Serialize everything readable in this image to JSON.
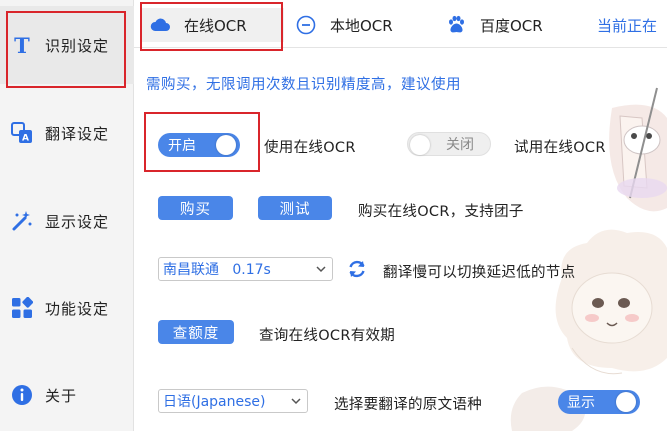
{
  "sidebar": {
    "items": [
      {
        "label": "识别设定",
        "icon": "text-t-icon"
      },
      {
        "label": "翻译设定",
        "icon": "translate-icon"
      },
      {
        "label": "显示设定",
        "icon": "magic-wand-icon"
      },
      {
        "label": "功能设定",
        "icon": "apps-icon"
      },
      {
        "label": "关于",
        "icon": "info-icon"
      }
    ]
  },
  "tabs": [
    {
      "label": "在线OCR",
      "icon": "cloud-icon"
    },
    {
      "label": "本地OCR",
      "icon": "minus-circle-icon"
    },
    {
      "label": "百度OCR",
      "icon": "baidu-paw-icon"
    }
  ],
  "tab_current_label": "当前正在",
  "main": {
    "notice": "需购买，无限调用次数且识别精度高，建议使用",
    "online_toggle": {
      "label": "开启",
      "state": "on"
    },
    "online_toggle_desc": "使用在线OCR",
    "trial_toggle": {
      "label": "关闭",
      "state": "off"
    },
    "trial_toggle_desc": "试用在线OCR",
    "buy_button": "购买",
    "test_button": "测试",
    "buy_desc": "购买在线OCR，支持团子",
    "node_select": "南昌联通   0.17s",
    "node_desc": "翻译慢可以切换延迟低的节点",
    "quota_button": "查额度",
    "quota_desc": "查询在线OCR有效期",
    "language_select": "日语(Japanese)",
    "language_desc": "选择要翻译的原文语种",
    "show_toggle": {
      "label": "显示",
      "state": "on"
    }
  },
  "colors": {
    "accent": "#4a86e8",
    "link": "#2f6fe4",
    "highlight_box": "#d9252b"
  }
}
